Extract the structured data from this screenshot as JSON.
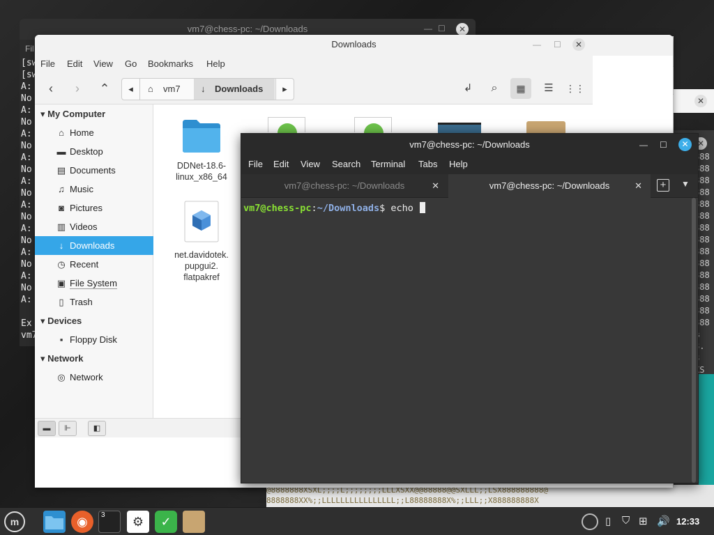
{
  "bg_terminal": {
    "title": "vm7@chess-pc: ~/Downloads",
    "menu_stub": "Fil",
    "lines": [
      "[sw",
      "[sw",
      "A:",
      "No",
      "A:",
      "No",
      "A:",
      "No",
      "A:",
      "No",
      "A:",
      "No",
      "A:",
      "No",
      "A:",
      "No",
      "A:",
      "No",
      "A:",
      "No",
      "A:",
      "",
      "Ex",
      "vm7"
    ]
  },
  "bg_windows": {
    "col3_lines": [
      "888",
      "888",
      "888",
      "888",
      "888",
      "888",
      "888",
      "888",
      "888",
      "888",
      "888",
      "888",
      "888",
      "888",
      "888",
      "%",
      "8.",
      "8",
      "XS"
    ],
    "pattern_row1": "@8888888XSXL;;;;L;;;;;;;;LLLXSXX@@88888@@SXLLL;;LSX888888888@",
    "pattern_row2": "8888888XX%;;LLLLLLLLLLLLLLLL;;L88888888X%;;LLL;;X888888888X"
  },
  "file_manager": {
    "title": "Downloads",
    "menu": [
      "File",
      "Edit",
      "View",
      "Go",
      "Bookmarks",
      "Help"
    ],
    "breadcrumb": [
      "vm7",
      "Downloads"
    ],
    "sidebar": {
      "sections": [
        {
          "title": "My Computer",
          "items": [
            {
              "label": "Home",
              "icon": "home-icon"
            },
            {
              "label": "Desktop",
              "icon": "desktop-icon"
            },
            {
              "label": "Documents",
              "icon": "documents-icon"
            },
            {
              "label": "Music",
              "icon": "music-icon"
            },
            {
              "label": "Pictures",
              "icon": "pictures-icon"
            },
            {
              "label": "Videos",
              "icon": "videos-icon"
            },
            {
              "label": "Downloads",
              "icon": "downloads-icon",
              "selected": true
            },
            {
              "label": "Recent",
              "icon": "recent-icon"
            },
            {
              "label": "File System",
              "icon": "filesystem-icon"
            },
            {
              "label": "Trash",
              "icon": "trash-icon"
            }
          ]
        },
        {
          "title": "Devices",
          "items": [
            {
              "label": "Floppy Disk",
              "icon": "floppy-icon"
            }
          ]
        },
        {
          "title": "Network",
          "items": [
            {
              "label": "Network",
              "icon": "network-icon"
            }
          ]
        }
      ]
    },
    "files": [
      {
        "name": "DDNet-18.6-linux_x86_64",
        "line1": "DDNet-18.6-",
        "line2": "linux_x86_64",
        "icon": "folder-icon"
      },
      {
        "name": "net.davidotek.pupgui2.flatpakref",
        "line1": "net.davidotek.",
        "line2": "pupgui2.",
        "line3": "flatpakref",
        "icon": "flatpakref-icon"
      }
    ],
    "accent": "#35a6e8"
  },
  "terminal": {
    "title": "vm7@chess-pc: ~/Downloads",
    "menu": [
      "File",
      "Edit",
      "View",
      "Search",
      "Terminal",
      "Tabs",
      "Help"
    ],
    "tabs": [
      {
        "label": "vm7@chess-pc: ~/Downloads",
        "active": false
      },
      {
        "label": "vm7@chess-pc: ~/Downloads",
        "active": true
      }
    ],
    "prompt_user": "vm7@chess-pc",
    "prompt_sep": ":",
    "prompt_path": "~/Downloads",
    "prompt_symbol": "$ ",
    "command": "echo "
  },
  "taskbar": {
    "terminal_badge": "3",
    "clock": "12:33"
  }
}
